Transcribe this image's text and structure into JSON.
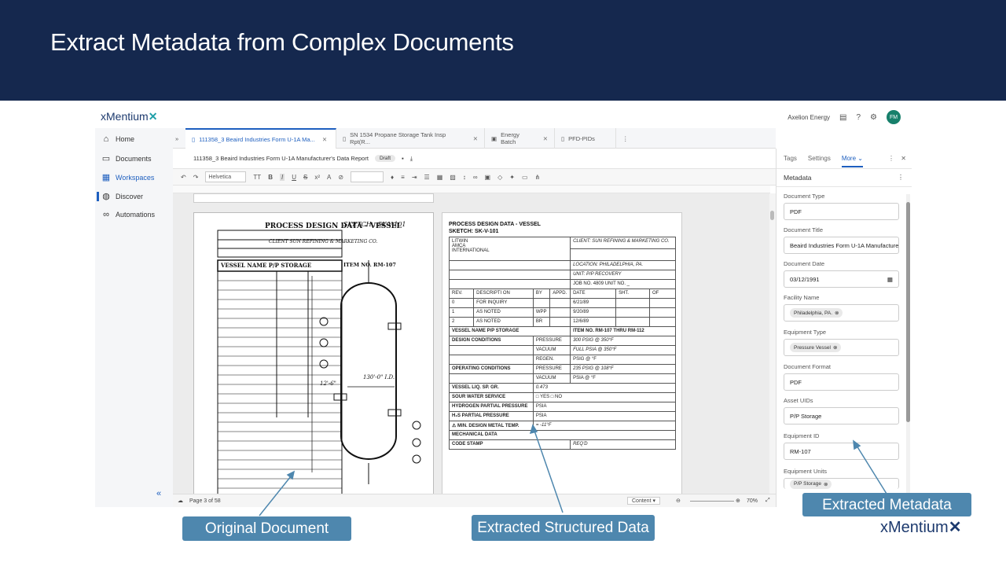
{
  "slide_title": "Extract Metadata from Complex Documents",
  "app": {
    "logo": "xMentium",
    "org": "Axelion Energy",
    "avatar": "FM",
    "nav": [
      {
        "label": "Home",
        "icon": "home-icon"
      },
      {
        "label": "Documents",
        "icon": "documents-icon"
      },
      {
        "label": "Workspaces",
        "icon": "workspaces-icon",
        "active": true
      },
      {
        "label": "Discover",
        "icon": "discover-icon"
      },
      {
        "label": "Automations",
        "icon": "automations-icon"
      }
    ],
    "tabs": [
      {
        "label": "111358_3 Beaird Industries Form U-1A Ma..."
      },
      {
        "label": "SN 1534 Propane Storage Tank Insp Rpt(R..."
      },
      {
        "label": "Energy Batch"
      },
      {
        "label": "PFD-PIDs"
      }
    ],
    "doc_title": "111358_3 Beaird Industries Form U-1A Manufacturer's Data Report",
    "doc_status": "Draft",
    "font": "Helvetica",
    "status_page": "Page 3 of 58",
    "status_content": "Content",
    "zoom": "70%",
    "right_panel": {
      "tabs": [
        "Tags",
        "Settings",
        "More"
      ],
      "heading": "Metadata",
      "fields": [
        {
          "label": "Document Type",
          "value": "PDF"
        },
        {
          "label": "Document Title",
          "value": "Beaird Industries Form U-1A Manufacture"
        },
        {
          "label": "Document Date",
          "value": "03/12/1991"
        },
        {
          "label": "Facility Name",
          "chip": "Philadelphia, PA."
        },
        {
          "label": "Equipment Type",
          "chip": "Pressure Vessel"
        },
        {
          "label": "Document Format",
          "value": "PDF"
        },
        {
          "label": "Asset UIDs",
          "value": "P/P Storage"
        },
        {
          "label": "Equipment ID",
          "value": "RM-107"
        },
        {
          "label": "Equipment Units",
          "chip": "P/P Storage"
        }
      ]
    }
  },
  "scan": {
    "title": "PROCESS DESIGN DATA - VESSEL",
    "sketch": "SKETCH : SK-V-101",
    "client": "CLIENT SUN REFINING & MARKETING CO.",
    "vessel_name": "VESSEL NAME P/P STORAGE",
    "item_no": "ITEM NO. RM-107",
    "dim1": "130'-0\" I.D.",
    "dim2": "12'-6\""
  },
  "typed": {
    "title": "PROCESS DESIGN DATA - VESSEL",
    "sketch": "SKETCH: SK-V-101",
    "company": "LITWIN\nAMCA\nINTERNATIONAL",
    "client": "CLIENT: SUN REFINING & MARKETING CO.",
    "location": "LOCATION: PHILADELPHIA, PA.",
    "unit": "UNIT: P/P RECOVERY",
    "job": "JOB NO. 4809 UNIT NO. _",
    "rev_headers": [
      "REV.",
      "DESCRIPTI ON",
      "BY",
      "APPD.",
      "DATE",
      "SHT.",
      "OF"
    ],
    "rev_rows": [
      [
        "0",
        "FOR INQUIRY",
        "",
        "",
        "6/21/89",
        "",
        ""
      ],
      [
        "1",
        "AS NOTED",
        "WPP",
        "",
        "9/20/89",
        "",
        ""
      ],
      [
        "2",
        "AS NOTED",
        "BR",
        "",
        "12/6/89",
        "",
        ""
      ]
    ],
    "vessel_name": "VESSEL NAME P/P STORAGE",
    "item_no": "ITEM NO. RM-107 THRU RM-112",
    "rows": [
      [
        "DESIGN CONDITIONS",
        "PRESSURE",
        "300 PSIG @ 350°F"
      ],
      [
        "",
        "VACUUM",
        "FULL PSIA @ 350°F"
      ],
      [
        "",
        "REGEN.",
        "PSIG @ °F"
      ],
      [
        "OPERATING CONDITIONS",
        "PRESSURE",
        "235 PSIG @ 108°F"
      ],
      [
        "",
        "VACUUM",
        "PSIA @ °F"
      ],
      [
        "VESSEL LIQ. SP. GR.",
        "0.473",
        ""
      ],
      [
        "SOUR WATER SERVICE",
        "□ YES □ NO",
        ""
      ],
      [
        "HYDROGEN PARTIAL PRESSURE",
        "PSIA",
        ""
      ],
      [
        "H₂S PARTIAL PRESSURE",
        "PSIA",
        ""
      ],
      [
        "⚠ MIN. DESIGN METAL TEMP.",
        "= -11°F",
        ""
      ],
      [
        "MECHANICAL DATA",
        "",
        ""
      ],
      [
        "CODE STAMP",
        "REQ'D",
        ""
      ]
    ]
  },
  "callouts": {
    "original": "Original Document",
    "structured": "Extracted Structured Data",
    "metadata": "Extracted Metadata"
  },
  "footer_logo": "xMentium",
  "colors": {
    "banner": "#15284e",
    "callout": "#4e87ae",
    "accent": "#1e5fbf"
  }
}
